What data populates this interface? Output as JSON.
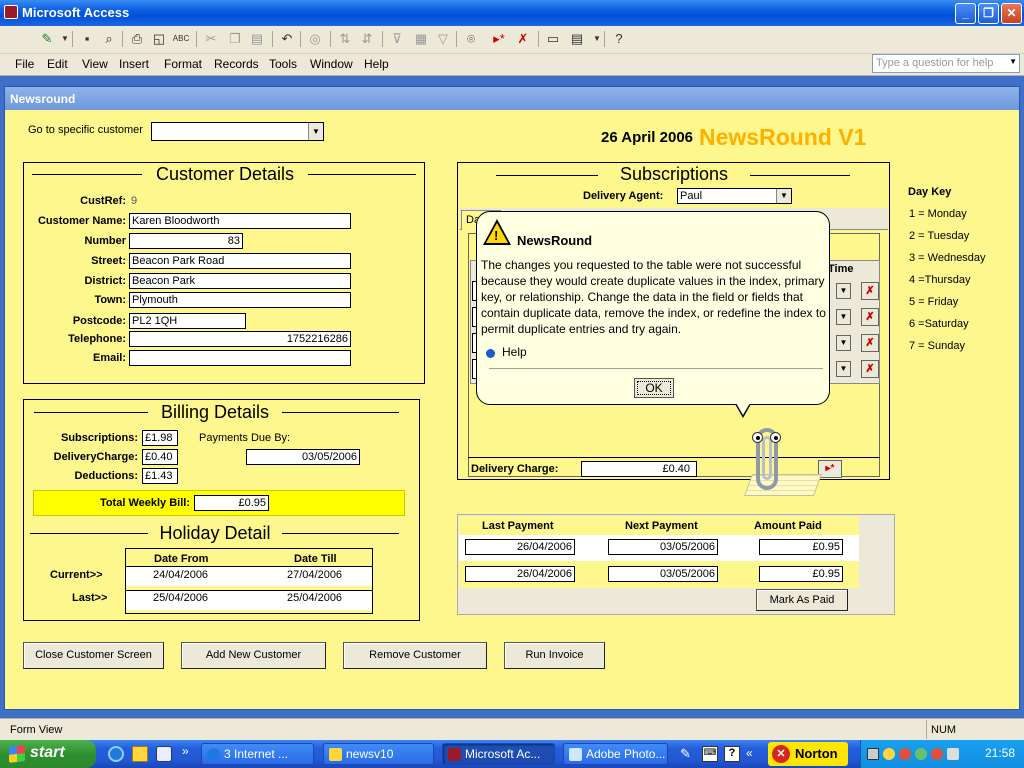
{
  "window": {
    "title": "Microsoft Access",
    "min": "_",
    "max": "❐",
    "close": "✕"
  },
  "menu": [
    "File",
    "Edit",
    "View",
    "Insert",
    "Format",
    "Records",
    "Tools",
    "Window",
    "Help"
  ],
  "ask_box": {
    "placeholder": "Type a question for help"
  },
  "form": {
    "title": "Newsround",
    "goto_label": "Go to specific customer",
    "goto_value": "",
    "date": "26 April 2006",
    "app_title": "NewsRound V1"
  },
  "customer": {
    "heading": "Customer Details",
    "custref_label": "CustRef:",
    "custref": "9",
    "name_label": "Customer Name:",
    "name": "Karen Bloodworth",
    "number_label": "Number",
    "number": "83",
    "street_label": "Street:",
    "street": "Beacon Park Road",
    "district_label": "District:",
    "district": "Beacon Park",
    "town_label": "Town:",
    "town": "Plymouth",
    "postcode_label": "Postcode:",
    "postcode": "PL2 1QH",
    "telephone_label": "Telephone:",
    "telephone": "1752216286",
    "email_label": "Email:",
    "email": ""
  },
  "billing": {
    "heading": "Billing Details",
    "subs_label": "Subscriptions:",
    "subs": "£1.98",
    "delivery_label": "DeliveryCharge:",
    "delivery": "£0.40",
    "deductions_label": "Deductions:",
    "deductions": "£1.43",
    "payments_due_label": "Payments Due By:",
    "payments_due": "03/05/2006",
    "total_label": "Total Weekly Bill:",
    "total": "£0.95"
  },
  "holiday": {
    "heading": "Holiday Detail",
    "col_from": "Date From",
    "col_till": "Date Till",
    "current_label": "Current>>",
    "current_from": "24/04/2006",
    "current_till": "27/04/2006",
    "last_label": "Last>>",
    "last_from": "25/04/2006",
    "last_till": "25/04/2006"
  },
  "subscriptions": {
    "heading": "Subscriptions",
    "agent_label": "Delivery Agent:",
    "agent": "Paul",
    "tab_partial": "Da",
    "col_time": "Time",
    "delivery_charge_label": "Delivery Charge:",
    "delivery_charge": "£0.40"
  },
  "payments": {
    "col_last": "Last Payment",
    "col_next": "Next Payment",
    "col_amount": "Amount Paid",
    "rows": [
      {
        "last": "26/04/2006",
        "next": "03/05/2006",
        "amount": "£0.95"
      },
      {
        "last": "26/04/2006",
        "next": "03/05/2006",
        "amount": "£0.95"
      }
    ],
    "mark_paid": "Mark As Paid"
  },
  "day_key": {
    "heading": "Day Key",
    "items": [
      "1 = Monday",
      "2 = Tuesday",
      "3 = Wednesday",
      "4 =Thursday",
      "5 = Friday",
      "6 =Saturday",
      "7 = Sunday"
    ]
  },
  "buttons": {
    "close": "Close Customer Screen",
    "add": "Add New Customer",
    "remove": "Remove Customer",
    "invoice": "Run Invoice"
  },
  "dialog": {
    "title": "NewsRound",
    "message": "The changes you requested to the table were not successful because they would create duplicate values in the index, primary key, or relationship.  Change the data in the field or fields that contain duplicate data, remove the index, or redefine the index to permit duplicate entries and try again.",
    "help": "Help",
    "ok": "OK"
  },
  "status": {
    "left": "Form View",
    "num": "NUM"
  },
  "taskbar": {
    "start": "start",
    "tasks": [
      "3 Internet ...",
      "newsv10",
      "Microsoft Ac...",
      "Adobe Photo..."
    ],
    "norton": "Norton",
    "clock": "21:58"
  },
  "colors": {
    "form_bg": "#fdf78d",
    "title_orange": "#ffb000",
    "total_bar": "#ffff00",
    "balloon_bg": "#ffffe1"
  }
}
